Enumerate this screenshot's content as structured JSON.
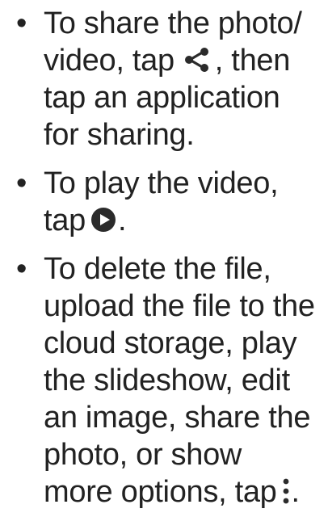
{
  "bullet_symbol": "•",
  "items": [
    {
      "lines": [
        "To share the photo/",
        "video, tap",
        ", then",
        "tap an application",
        "for sharing."
      ],
      "icon": "share-icon"
    },
    {
      "lines": [
        "To play the video,",
        "tap",
        "."
      ],
      "icon": "play-circle-icon"
    },
    {
      "lines": [
        "To delete the file,",
        "upload the file to the",
        "cloud storage, play",
        "the slideshow, edit",
        "an image, share the",
        "photo, or show",
        "more options, tap",
        "."
      ],
      "icon": "more-options-icon"
    }
  ],
  "colors": {
    "text": "#222222",
    "icon": "#2b2b2b"
  }
}
